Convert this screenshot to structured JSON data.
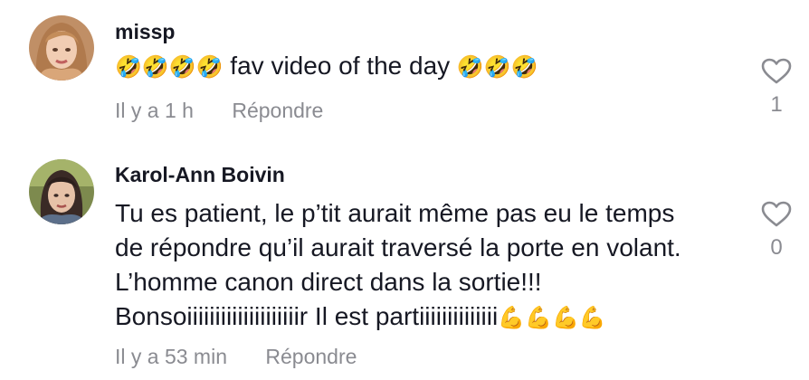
{
  "comments": [
    {
      "username": "missp",
      "text_emoji_before": "🤣🤣🤣🤣",
      "text": " fav video of the day ",
      "text_emoji_after": "🤣🤣🤣",
      "time": "Il y a 1 h",
      "reply_label": "Répondre",
      "likes": "1",
      "avatar_icon": "avatar-photo-missp"
    },
    {
      "username": "Karol-Ann Boivin",
      "lines": [
        "Tu es patient, le p’tit aurait même pas eu le temps",
        "de répondre qu’il aurait traversé la porte en volant.",
        "L’homme canon direct dans la sortie!!!",
        "Bonsoiiiiiiiiiiiiiiiiiiiir Il est partiiiiiiiiiiiiii"
      ],
      "line4_emoji": "💪💪💪💪",
      "time": "Il y a 53 min",
      "reply_label": "Répondre",
      "likes": "0",
      "avatar_icon": "avatar-photo-karol-ann"
    }
  ],
  "colors": {
    "text_primary": "#161823",
    "text_secondary": "#8a8b91",
    "heart_outline": "#8a8b91"
  }
}
